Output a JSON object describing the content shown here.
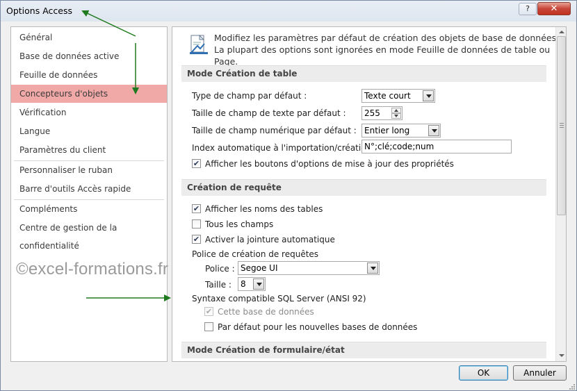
{
  "window": {
    "title": "Options Access",
    "help_label": "?",
    "close_label": "✕"
  },
  "nav": {
    "items": [
      {
        "label": "Général",
        "active": false
      },
      {
        "label": "Base de données active",
        "active": false
      },
      {
        "label": "Feuille de données",
        "active": false
      },
      {
        "label": "Concepteurs d'objets",
        "active": true
      },
      {
        "label": "Vérification",
        "active": false
      },
      {
        "label": "Langue",
        "active": false
      },
      {
        "label": "Paramètres du client",
        "active": false
      },
      {
        "label": "Personnaliser le ruban",
        "active": false
      },
      {
        "label": "Barre d'outils Accès rapide",
        "active": false
      },
      {
        "label": "Compléments",
        "active": false
      },
      {
        "label": "Centre de gestion de la confidentialité",
        "active": false
      }
    ]
  },
  "watermark": "©excel-formations.fr",
  "content": {
    "intro": "Modifiez les paramètres par défaut de création des objets de base de données. La plupart des options sont ignorées en mode Feuille de données de table ou Page.",
    "table_design": {
      "header": "Mode Création de table",
      "field_type_label": "Type de champ par défaut :",
      "field_type_value": "Texte court",
      "text_size_label": "Taille de champ de texte par défaut :",
      "text_size_value": "255",
      "number_size_label": "Taille de champ numérique par défaut :",
      "number_size_value": "Entier long",
      "autoindex_label": "Index automatique à l'importation/création :",
      "autoindex_value": "N°;clé;code;num",
      "show_update_options_label": "Afficher les boutons d'options de mise à jour des propriétés",
      "show_update_options_checked": true
    },
    "query_design": {
      "header": "Création de requête",
      "show_table_names_label": "Afficher les noms des tables",
      "show_table_names_checked": true,
      "all_fields_label": "Tous les champs",
      "all_fields_checked": false,
      "autojoin_label": "Activer la jointure automatique",
      "autojoin_checked": true,
      "font_group_label": "Police de création de requêtes",
      "font_label": "Police :",
      "font_value": "Segoe UI",
      "size_label": "Taille :",
      "size_value": "8",
      "sql_label": "Syntaxe compatible SQL Server (ANSI 92)",
      "this_db_label": "Cette base de données",
      "this_db_checked": true,
      "this_db_disabled": true,
      "new_db_default_label": "Par défaut pour les nouvelles bases de données",
      "new_db_default_checked": false
    },
    "form_design": {
      "header": "Mode Création de formulaire/état"
    }
  },
  "buttons": {
    "ok": "OK",
    "cancel": "Annuler"
  },
  "colors": {
    "active_nav": "#f1a9a8",
    "annotation_arrow": "#1f7a1f",
    "close_button": "#c7463a"
  },
  "icons": {
    "intro": "design-settings-icon",
    "check": "✔"
  }
}
